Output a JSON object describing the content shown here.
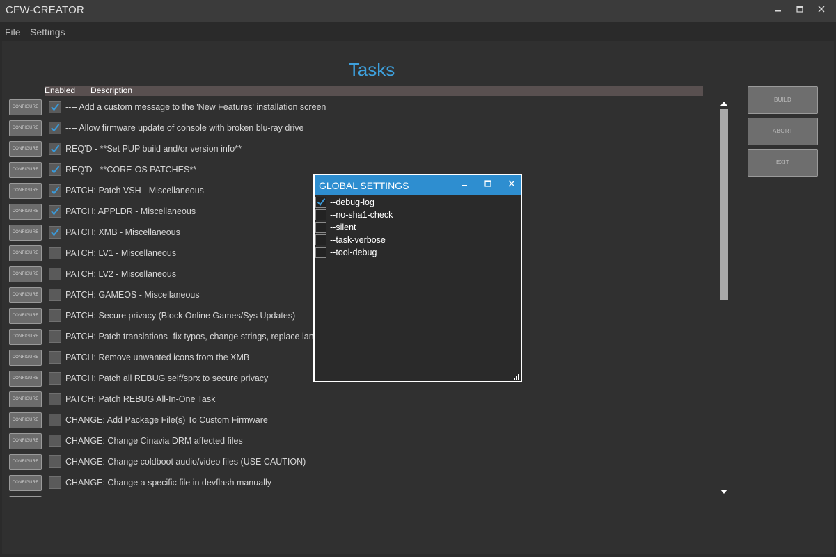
{
  "window": {
    "title": "CFW-CREATOR",
    "controls": {
      "minimize": "▁",
      "maximize": "☐",
      "close": "✕"
    }
  },
  "menu": {
    "file": "File",
    "settings": "Settings"
  },
  "main": {
    "title": "Tasks",
    "columns": {
      "enabled": "Enabled",
      "description": "Description"
    },
    "configure_label": "CONFIGURE",
    "tasks": [
      {
        "label": "---- Add a custom message to the 'New Features' installation screen",
        "enabled": true
      },
      {
        "label": "---- Allow firmware update of console with broken blu-ray drive",
        "enabled": true
      },
      {
        "label": "REQ'D - **Set PUP build and/or version info**",
        "enabled": true
      },
      {
        "label": "REQ'D - **CORE-OS PATCHES**",
        "enabled": true
      },
      {
        "label": "PATCH: Patch VSH - Miscellaneous",
        "enabled": true
      },
      {
        "label": "PATCH: APPLDR - Miscellaneous",
        "enabled": true
      },
      {
        "label": "PATCH: XMB - Miscellaneous",
        "enabled": true
      },
      {
        "label": "PATCH: LV1 - Miscellaneous",
        "enabled": false
      },
      {
        "label": "PATCH: LV2 - Miscellaneous",
        "enabled": false
      },
      {
        "label": "PATCH: GAMEOS - Miscellaneous",
        "enabled": false
      },
      {
        "label": "PATCH: Secure privacy (Block Online Games/Sys Updates)",
        "enabled": false
      },
      {
        "label": "PATCH: Patch translations- fix typos, change strings, replace langua",
        "enabled": false
      },
      {
        "label": "PATCH: Remove unwanted icons from the XMB",
        "enabled": false
      },
      {
        "label": "PATCH: Patch all REBUG self/sprx to secure privacy",
        "enabled": false
      },
      {
        "label": "PATCH: Patch REBUG All-In-One Task",
        "enabled": false
      },
      {
        "label": "CHANGE: Add Package File(s) To Custom Firmware",
        "enabled": false
      },
      {
        "label": "CHANGE: Change Cinavia DRM affected files",
        "enabled": false
      },
      {
        "label": "CHANGE: Change coldboot audio/video files (USE CAUTION)",
        "enabled": false
      },
      {
        "label": "CHANGE: Change a specific file in devflash manually",
        "enabled": false
      }
    ],
    "scrollbar": {
      "up": "▲",
      "down": "▼"
    }
  },
  "actions": {
    "build": "BUILD",
    "abort": "ABORT",
    "exit": "EXIT"
  },
  "dialog": {
    "title": "GLOBAL SETTINGS",
    "options": [
      {
        "label": "--debug-log",
        "checked": true
      },
      {
        "label": "--no-sha1-check",
        "checked": false
      },
      {
        "label": "--silent",
        "checked": false
      },
      {
        "label": "--task-verbose",
        "checked": false
      },
      {
        "label": "--tool-debug",
        "checked": false
      }
    ]
  },
  "colors": {
    "accent": "#2e8ed0",
    "title_text": "#3ea0dc",
    "check": "#3a9ad9"
  }
}
